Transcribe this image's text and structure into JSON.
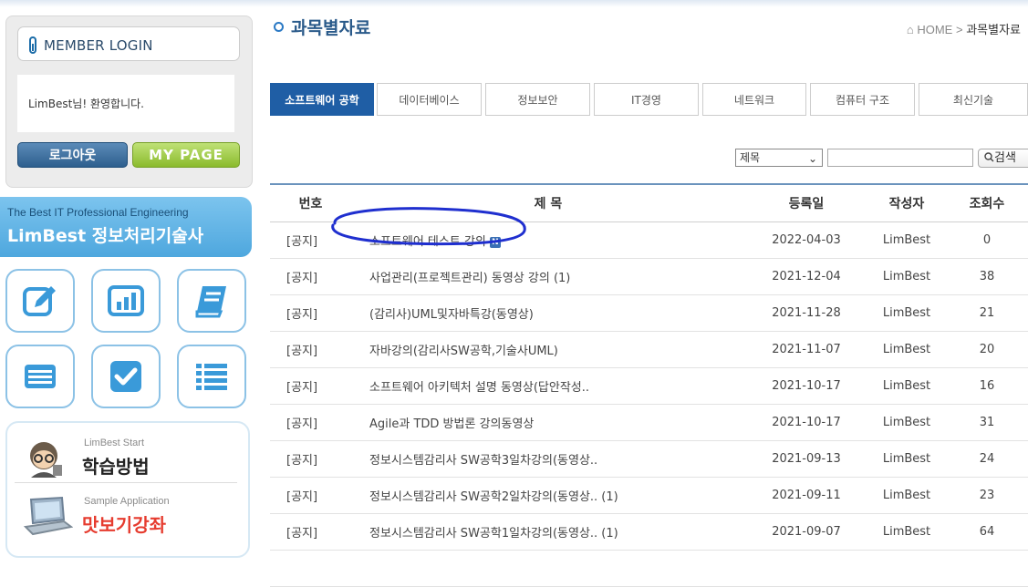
{
  "sidebar": {
    "login_title": "MEMBER LOGIN",
    "welcome": "LimBest님! 환영합니다.",
    "logout_label": "로그아웃",
    "mypage_label": "MY PAGE",
    "banner_line1": "The Best IT Professional Engineering",
    "banner_line2": "LimBest 정보처리기술사",
    "icons": [
      "pencil-note-icon",
      "bar-chart-icon",
      "book-icon",
      "list-card-icon",
      "checkbox-icon",
      "bullet-list-icon"
    ],
    "learn": [
      {
        "small": "LimBest Start",
        "big": "학습방법",
        "color": "#222222",
        "icon": "student-avatar-icon"
      },
      {
        "small": "Sample Application",
        "big": "맛보기강좌",
        "color": "#e63c2f",
        "icon": "laptop-icon"
      }
    ]
  },
  "main": {
    "title": "과목별자료",
    "breadcrumb_home": "HOME",
    "breadcrumb_sep": ">",
    "breadcrumb_current": "과목별자료",
    "tabs": [
      {
        "label": "소프트웨어 공학",
        "active": true
      },
      {
        "label": "데이터베이스",
        "active": false
      },
      {
        "label": "정보보안",
        "active": false
      },
      {
        "label": "IT경영",
        "active": false
      },
      {
        "label": "네트워크",
        "active": false
      },
      {
        "label": "컴퓨터 구조",
        "active": false
      },
      {
        "label": "최신기술",
        "active": false
      }
    ],
    "search_field_selected": "제목",
    "search_button": "검색",
    "columns": [
      "번호",
      "제 목",
      "등록일",
      "작성자",
      "조회수"
    ],
    "rows": [
      {
        "num": "[공지]",
        "title": "소프트웨어 테스트 강의",
        "new": true,
        "date": "2022-04-03",
        "author": "LimBest",
        "views": "0"
      },
      {
        "num": "[공지]",
        "title": "사업관리(프로젝트관리) 동영상 강의 (1)",
        "new": false,
        "date": "2021-12-04",
        "author": "LimBest",
        "views": "38"
      },
      {
        "num": "[공지]",
        "title": "(감리사)UML및자바특강(동영상)",
        "new": false,
        "date": "2021-11-28",
        "author": "LimBest",
        "views": "21"
      },
      {
        "num": "[공지]",
        "title": "자바강의(감리사SW공학,기술사UML)",
        "new": false,
        "date": "2021-11-07",
        "author": "LimBest",
        "views": "20"
      },
      {
        "num": "[공지]",
        "title": "소프트웨어 아키텍처 설명 동영상(답안작성..",
        "new": false,
        "date": "2021-10-17",
        "author": "LimBest",
        "views": "16"
      },
      {
        "num": "[공지]",
        "title": "Agile과 TDD 방법론 강의동영상",
        "new": false,
        "date": "2021-10-17",
        "author": "LimBest",
        "views": "31"
      },
      {
        "num": "[공지]",
        "title": "정보시스템감리사 SW공학3일차강의(동영상..",
        "new": false,
        "date": "2021-09-13",
        "author": "LimBest",
        "views": "24"
      },
      {
        "num": "[공지]",
        "title": "정보시스템감리사 SW공학2일차강의(동영상.. (1)",
        "new": false,
        "date": "2021-09-11",
        "author": "LimBest",
        "views": "23"
      },
      {
        "num": "[공지]",
        "title": "정보시스템감리사 SW공학1일차강의(동영상.. (1)",
        "new": false,
        "date": "2021-09-07",
        "author": "LimBest",
        "views": "64"
      }
    ],
    "new_badge": "N"
  }
}
